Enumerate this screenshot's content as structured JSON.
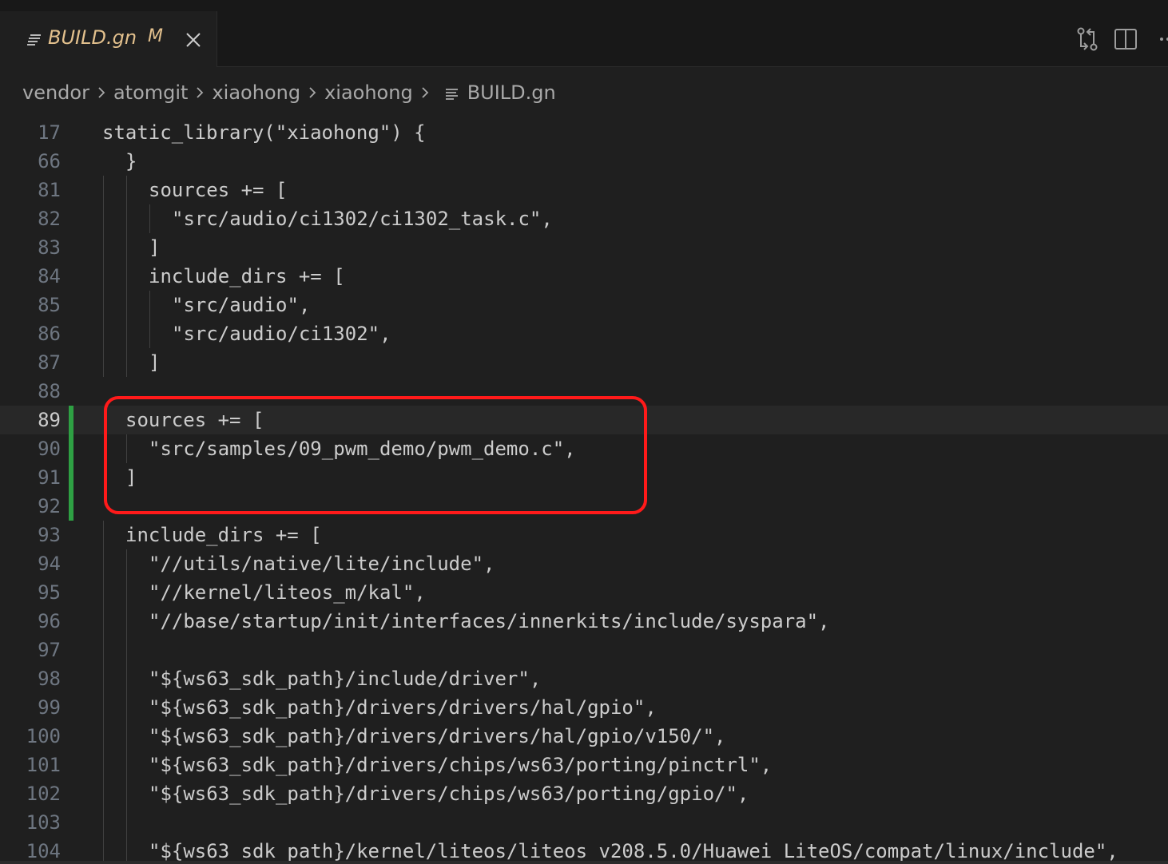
{
  "tab": {
    "title": "BUILD.gn",
    "status": "M",
    "icon": "file-lines-icon",
    "close_icon": "close-icon"
  },
  "editor_actions": [
    {
      "name": "compare-changes-icon"
    },
    {
      "name": "split-editor-icon"
    },
    {
      "name": "more-actions-icon"
    }
  ],
  "breadcrumb": {
    "items": [
      "vendor",
      "atomgit",
      "xiaohong",
      "xiaohong"
    ],
    "file": "BUILD.gn"
  },
  "colors": {
    "tab_title": "#e2c08d",
    "annotation_box": "#ff1a1a",
    "modified_gutter": "#2ea043"
  },
  "code_lines": [
    {
      "n": "17",
      "indent": 0,
      "text": "static_library(\"xiaohong\") {"
    },
    {
      "n": "66",
      "indent": 1,
      "text": "}"
    },
    {
      "n": "81",
      "indent": 2,
      "text": "sources += ["
    },
    {
      "n": "82",
      "indent": 3,
      "text": "\"src/audio/ci1302/ci1302_task.c\","
    },
    {
      "n": "83",
      "indent": 2,
      "text": "]"
    },
    {
      "n": "84",
      "indent": 2,
      "text": "include_dirs += ["
    },
    {
      "n": "85",
      "indent": 3,
      "text": "\"src/audio\","
    },
    {
      "n": "86",
      "indent": 3,
      "text": "\"src/audio/ci1302\","
    },
    {
      "n": "87",
      "indent": 2,
      "text": "]"
    },
    {
      "n": "88",
      "indent": 0,
      "text": ""
    },
    {
      "n": "89",
      "indent": 1,
      "text": "sources += ["
    },
    {
      "n": "90",
      "indent": 2,
      "text": "\"src/samples/09_pwm_demo/pwm_demo.c\","
    },
    {
      "n": "91",
      "indent": 1,
      "text": "]"
    },
    {
      "n": "92",
      "indent": 0,
      "text": ""
    },
    {
      "n": "93",
      "indent": 1,
      "text": "include_dirs += ["
    },
    {
      "n": "94",
      "indent": 2,
      "text": "\"//utils/native/lite/include\","
    },
    {
      "n": "95",
      "indent": 2,
      "text": "\"//kernel/liteos_m/kal\","
    },
    {
      "n": "96",
      "indent": 2,
      "text": "\"//base/startup/init/interfaces/innerkits/include/syspara\","
    },
    {
      "n": "97",
      "indent": 0,
      "text": ""
    },
    {
      "n": "98",
      "indent": 2,
      "text": "\"${ws63_sdk_path}/include/driver\","
    },
    {
      "n": "99",
      "indent": 2,
      "text": "\"${ws63_sdk_path}/drivers/drivers/hal/gpio\","
    },
    {
      "n": "100",
      "indent": 2,
      "text": "\"${ws63_sdk_path}/drivers/drivers/hal/gpio/v150/\","
    },
    {
      "n": "101",
      "indent": 2,
      "text": "\"${ws63_sdk_path}/drivers/chips/ws63/porting/pinctrl\","
    },
    {
      "n": "102",
      "indent": 2,
      "text": "\"${ws63_sdk_path}/drivers/chips/ws63/porting/gpio/\","
    },
    {
      "n": "103",
      "indent": 0,
      "text": ""
    },
    {
      "n": "104",
      "indent": 2,
      "text": "\"${ws63_sdk_path}/kernel/liteos/liteos_v208.5.0/Huawei_LiteOS/compat/linux/include\","
    }
  ],
  "current_line": "89"
}
